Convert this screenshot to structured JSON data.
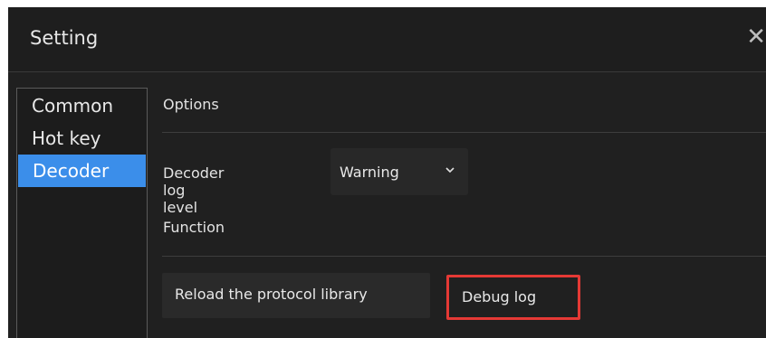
{
  "window": {
    "title": "Setting",
    "close_glyph": "✕"
  },
  "sidebar": {
    "items": [
      {
        "label": "Common",
        "selected": false
      },
      {
        "label": "Hot key",
        "selected": false
      },
      {
        "label": "Decoder",
        "selected": true
      }
    ]
  },
  "main": {
    "options_label": "Options",
    "decoder_log_level_label": "Decoder log level",
    "decoder_log_level_value": "Warning",
    "function_label": "Function",
    "reload_button_label": "Reload the protocol library",
    "debug_button_label": "Debug log"
  },
  "colors": {
    "accent": "#3b8eea",
    "highlight_border": "#e53935",
    "background": "#202020"
  }
}
